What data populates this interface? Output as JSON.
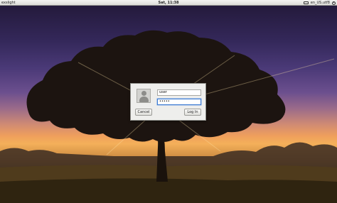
{
  "topbar": {
    "hostname": "exslight",
    "clock": "Sat, 11:38",
    "locale": "en_US.utf8"
  },
  "login": {
    "username_value": "user",
    "password_masked": "•••••",
    "cancel_label": "Cancel",
    "login_label": "Log In"
  },
  "icons": [
    "keyboard-icon",
    "power-icon",
    "user-avatar-icon"
  ]
}
